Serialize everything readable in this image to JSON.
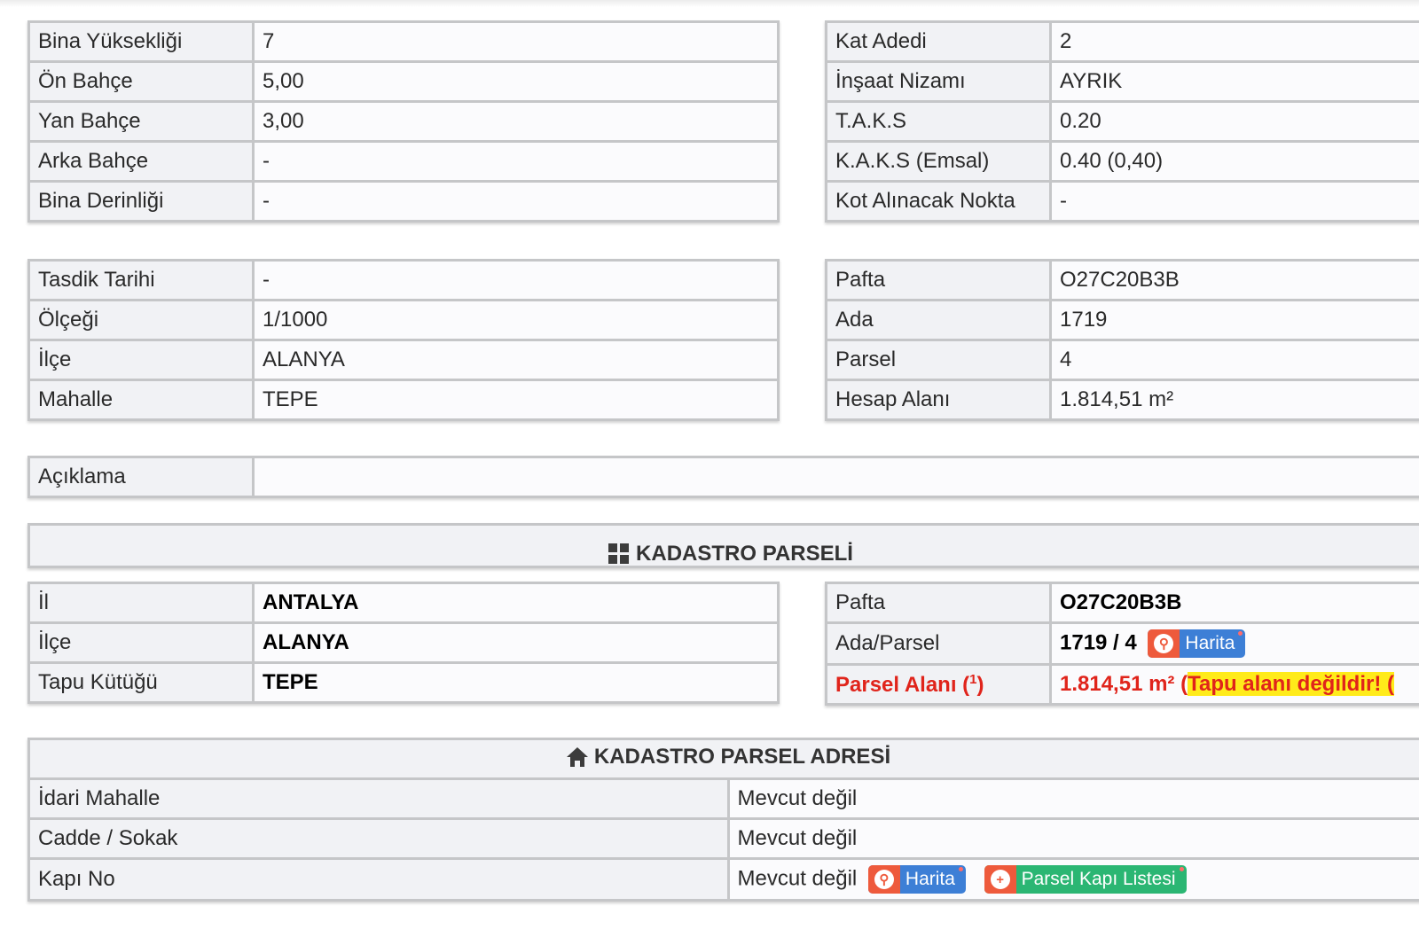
{
  "zoning_left": [
    {
      "key": "Bina Yüksekliği",
      "value": "7"
    },
    {
      "key": "Ön Bahçe",
      "value": "5,00"
    },
    {
      "key": "Yan Bahçe",
      "value": "3,00"
    },
    {
      "key": "Arka Bahçe",
      "value": "-"
    },
    {
      "key": "Bina Derinliği",
      "value": "-"
    }
  ],
  "zoning_right": [
    {
      "key": "Kat Adedi",
      "value": "2"
    },
    {
      "key": "İnşaat Nizamı",
      "value": "AYRIK"
    },
    {
      "key": "T.A.K.S",
      "value": "0.20"
    },
    {
      "key": "K.A.K.S (Emsal)",
      "value": "0.40 (0,40)"
    },
    {
      "key": "Kot Alınacak Nokta",
      "value": "-"
    }
  ],
  "plan_left": [
    {
      "key": "Tasdik Tarihi",
      "value": "-"
    },
    {
      "key": "Ölçeği",
      "value": "1/1000"
    },
    {
      "key": "İlçe",
      "value": "ALANYA"
    },
    {
      "key": "Mahalle",
      "value": "TEPE"
    }
  ],
  "plan_right": [
    {
      "key": "Pafta",
      "value": "O27C20B3B"
    },
    {
      "key": "Ada",
      "value": "1719"
    },
    {
      "key": "Parsel",
      "value": "4"
    },
    {
      "key": "Hesap Alanı",
      "value": "1.814,51 m²"
    }
  ],
  "aciklama": {
    "key": "Açıklama",
    "value": ""
  },
  "kadastro": {
    "title": "KADASTRO PARSELİ",
    "left": [
      {
        "key": "İl",
        "value": "ANTALYA"
      },
      {
        "key": "İlçe",
        "value": "ALANYA"
      },
      {
        "key": "Tapu Kütüğü",
        "value": "TEPE"
      }
    ],
    "pafta_key": "Pafta",
    "pafta_value": "O27C20B3B",
    "ada_key": "Ada/Parsel",
    "ada_value": "1719 / 4",
    "map_button": "Harita",
    "area_key": "Parsel Alanı (",
    "area_sup": "1",
    "area_key_end": ")",
    "area_value": "1.814,51 m² (",
    "area_note": "Tapu alanı değildir! (",
    "colors": {
      "red": "#e0241b",
      "highlight": "#ffeb1a",
      "map_blue": "#3d7fd6",
      "list_green": "#2bb673",
      "icon_orange": "#ee5a3c"
    }
  },
  "adres": {
    "title": "KADASTRO PARSEL ADRESİ",
    "rows": [
      {
        "key": "İdari Mahalle",
        "value": "Mevcut değil"
      },
      {
        "key": "Cadde / Sokak",
        "value": "Mevcut değil"
      },
      {
        "key": "Kapı No",
        "value": "Mevcut değil"
      }
    ],
    "map_button": "Harita",
    "list_button": "Parsel Kapı Listesi"
  },
  "icons": [
    "grid-icon",
    "home-icon",
    "map-pin-icon",
    "plus-circle-icon"
  ]
}
